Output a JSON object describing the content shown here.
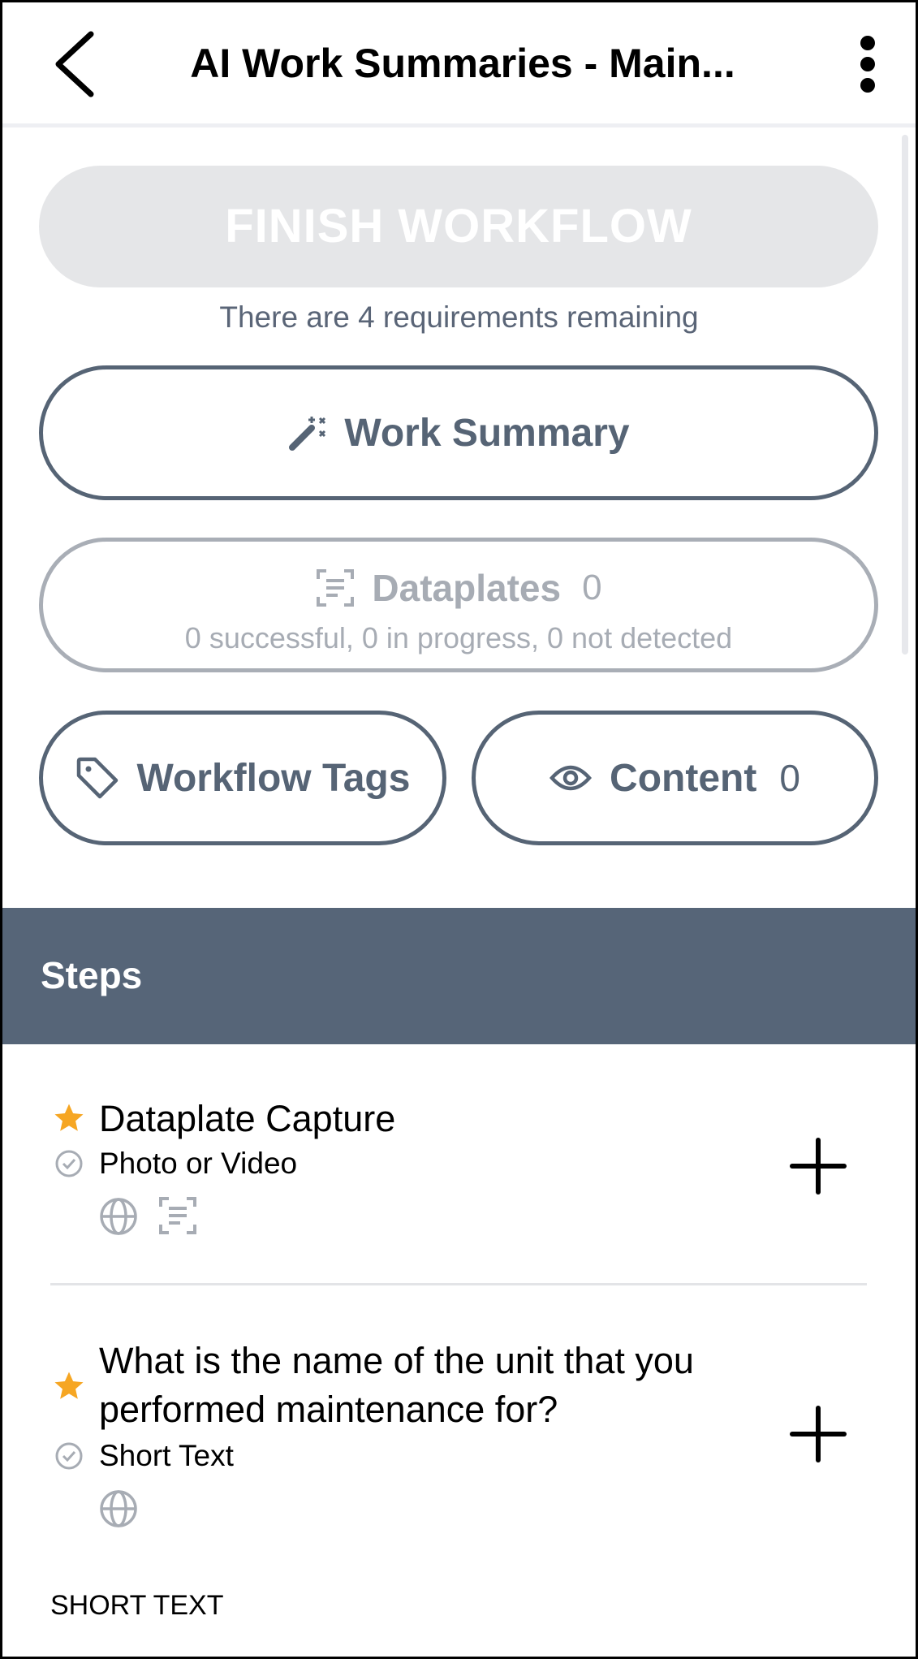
{
  "header": {
    "title": "AI Work Summaries - Main...",
    "back_icon": "chevron-left-icon",
    "menu_icon": "more-vertical-icon"
  },
  "actions": {
    "finish_label": "FINISH WORKFLOW",
    "requirements_text": "There are 4 requirements remaining",
    "work_summary_label": "Work Summary",
    "dataplates_label": "Dataplates",
    "dataplates_count": "0",
    "dataplates_status": "0 successful, 0 in progress, 0 not detected",
    "workflow_tags_label": "Workflow Tags",
    "content_label": "Content",
    "content_count": "0"
  },
  "steps": {
    "heading": "Steps",
    "items": [
      {
        "title": "Dataplate Capture",
        "type": "Photo or Video"
      },
      {
        "title_line1": "What is the name of the unit that you",
        "title_line2": "performed maintenance for?",
        "type": "Short Text"
      }
    ],
    "footer_label": "SHORT TEXT"
  },
  "colors": {
    "accent": "#566475",
    "steps_bar": "#566578",
    "star": "#f6a623",
    "disabled": "#e5e6e8",
    "muted": "#a7acb4"
  }
}
